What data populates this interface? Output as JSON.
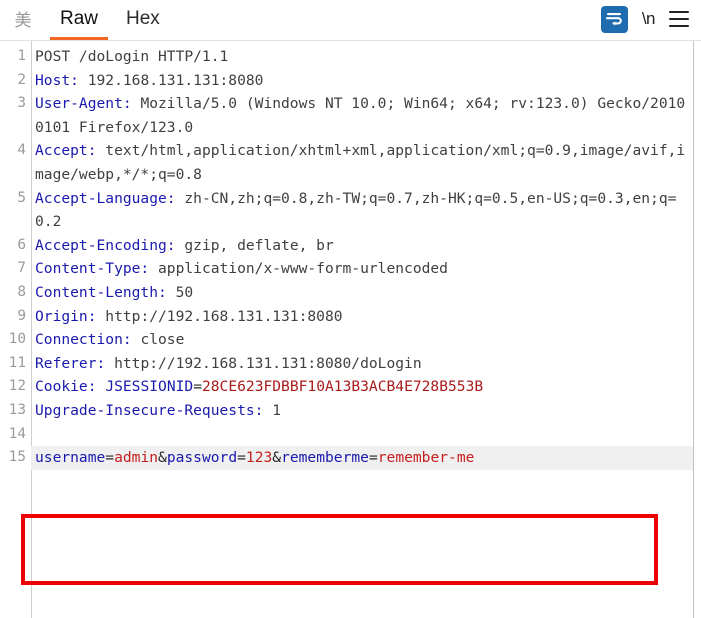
{
  "toolbar": {
    "lang_glyph": "美",
    "tabs": [
      {
        "label": "Raw",
        "active": true
      },
      {
        "label": "Hex",
        "active": false
      }
    ],
    "word_wrap_icon": "word-wrap-icon",
    "newline_label": "\\n",
    "menu_icon": "hamburger-menu-icon",
    "accent_color": "#f26522",
    "wrap_button_color": "#1f6bb0"
  },
  "editor": {
    "highlight_color": "#f0f0f0",
    "annotation_color": "#ee0000",
    "lines": [
      {
        "number": "1",
        "segments": [
          {
            "text": "POST /doLogin HTTP/1.1",
            "style": "v"
          }
        ]
      },
      {
        "number": "2",
        "segments": [
          {
            "text": "Host:",
            "style": "k"
          },
          {
            "text": " 192.168.131.131:8080",
            "style": "v"
          }
        ]
      },
      {
        "number": "3",
        "segments": [
          {
            "text": "User-Agent:",
            "style": "k"
          },
          {
            "text": " Mozilla/5.0 (Windows NT 10.0; Win64; x64; rv:123.0) Gecko/20100101 Firefox/123.0",
            "style": "v"
          }
        ]
      },
      {
        "number": "4",
        "segments": [
          {
            "text": "Accept:",
            "style": "k"
          },
          {
            "text": " text/html,application/xhtml+xml,application/xml;q=0.9,image/avif,image/webp,*/*;q=0.8",
            "style": "v"
          }
        ]
      },
      {
        "number": "5",
        "segments": [
          {
            "text": "Accept-Language:",
            "style": "k"
          },
          {
            "text": " zh-CN,zh;q=0.8,zh-TW;q=0.7,zh-HK;q=0.5,en-US;q=0.3,en;q=0.2",
            "style": "v"
          }
        ]
      },
      {
        "number": "6",
        "segments": [
          {
            "text": "Accept-Encoding:",
            "style": "k"
          },
          {
            "text": " gzip, deflate, br",
            "style": "v"
          }
        ]
      },
      {
        "number": "7",
        "segments": [
          {
            "text": "Content-Type:",
            "style": "k"
          },
          {
            "text": " application/x-www-form-urlencoded",
            "style": "v"
          }
        ]
      },
      {
        "number": "8",
        "segments": [
          {
            "text": "Content-Length:",
            "style": "k"
          },
          {
            "text": " 50",
            "style": "v"
          }
        ]
      },
      {
        "number": "9",
        "segments": [
          {
            "text": "Origin:",
            "style": "k"
          },
          {
            "text": " http://192.168.131.131:8080",
            "style": "v"
          }
        ]
      },
      {
        "number": "10",
        "segments": [
          {
            "text": "Connection:",
            "style": "k"
          },
          {
            "text": " close",
            "style": "v"
          }
        ]
      },
      {
        "number": "11",
        "segments": [
          {
            "text": "Referer:",
            "style": "k"
          },
          {
            "text": " http://192.168.131.131:8080/doLogin",
            "style": "v"
          }
        ]
      },
      {
        "number": "12",
        "segments": [
          {
            "text": "Cookie:",
            "style": "k"
          },
          {
            "text": " ",
            "style": "v"
          },
          {
            "text": "JSESSIONID",
            "style": "k"
          },
          {
            "text": "=",
            "style": "p"
          },
          {
            "text": "28CE623FDBBF10A13B3ACB4E728B553B",
            "style": "rd"
          }
        ]
      },
      {
        "number": "13",
        "segments": [
          {
            "text": "Upgrade-Insecure-Requests:",
            "style": "k"
          },
          {
            "text": " 1",
            "style": "v"
          }
        ]
      },
      {
        "number": "14",
        "segments": []
      },
      {
        "number": "15",
        "highlighted": true,
        "segments": [
          {
            "text": "username",
            "style": "k"
          },
          {
            "text": "=",
            "style": "p"
          },
          {
            "text": "admin",
            "style": "rd2"
          },
          {
            "text": "&",
            "style": "p"
          },
          {
            "text": "password",
            "style": "k"
          },
          {
            "text": "=",
            "style": "p"
          },
          {
            "text": "123",
            "style": "rd2"
          },
          {
            "text": "&",
            "style": "p"
          },
          {
            "text": "rememberme",
            "style": "k"
          },
          {
            "text": "=",
            "style": "p"
          },
          {
            "text": "remember-me",
            "style": "rd2"
          }
        ]
      }
    ]
  }
}
